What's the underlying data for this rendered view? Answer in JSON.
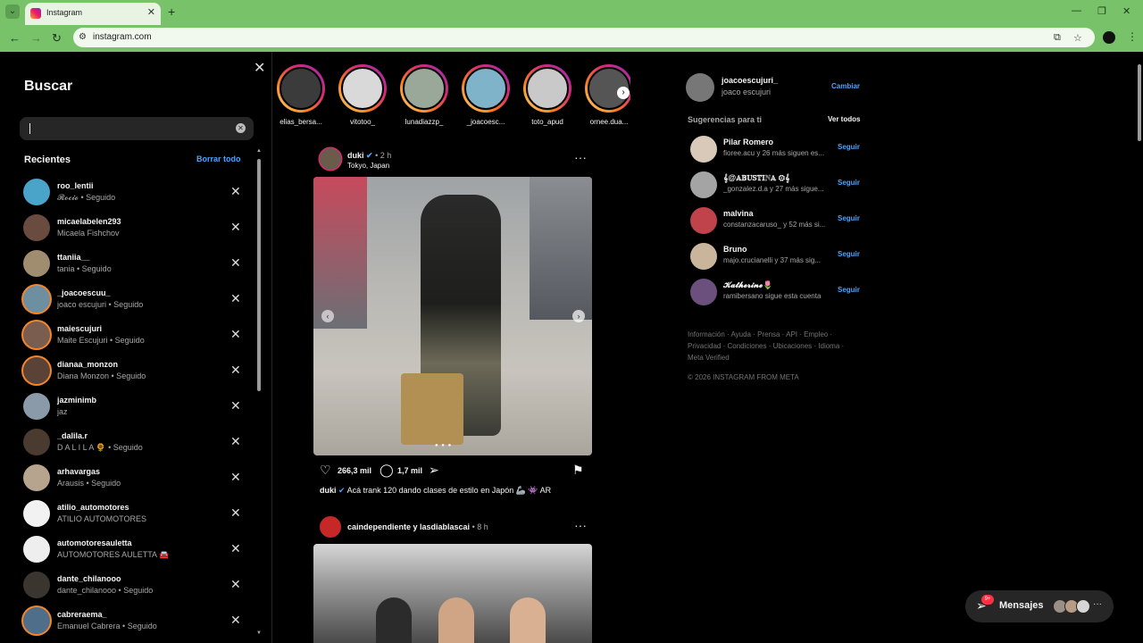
{
  "browser": {
    "tab_title": "Instagram",
    "url": "instagram.com"
  },
  "search": {
    "title": "Buscar",
    "input_value": "",
    "recent_title": "Recientes",
    "clear_all": "Borrar todo",
    "recents": [
      {
        "user": "roo_lentii",
        "sub": "𝓡𝓸𝓬𝓲𝓸 • Seguido",
        "avatar_color": "#4aa3c9"
      },
      {
        "user": "micaelabelen293",
        "sub": "Micaela Fishchov",
        "avatar_color": "#6a4b3f"
      },
      {
        "user": "ttaniia__",
        "sub": "tania • Seguido",
        "avatar_color": "#a08c6e"
      },
      {
        "user": "_joacoescuu_",
        "sub": "joaco escujuri • Seguido",
        "avatar_color": "#6d8fa0"
      },
      {
        "user": "maiescujuri",
        "sub": "Maite Escujuri • Seguido",
        "avatar_color": "#7a5d4f"
      },
      {
        "user": "dianaa_monzon",
        "sub": "Diana Monzon • Seguido",
        "avatar_color": "#5b4236"
      },
      {
        "user": "jazminimb",
        "sub": "jaz",
        "avatar_color": "#8a9aa8"
      },
      {
        "user": "_dalila.r",
        "sub": "D A L I L A 🌻 • Seguido",
        "avatar_color": "#4a3a30"
      },
      {
        "user": "arhavargas",
        "sub": "Arausis • Seguido",
        "avatar_color": "#b6a48f"
      },
      {
        "user": "atilio_automotores",
        "sub": "ATILIO AUTOMOTORES",
        "avatar_color": "#f2f2f2"
      },
      {
        "user": "automotoresauletta",
        "sub": "AUTOMOTORES AULETTA 🚘",
        "avatar_color": "#eeeeee"
      },
      {
        "user": "dante_chilanooo",
        "sub": "dante_chilanooo • Seguido",
        "avatar_color": "#3a352f"
      },
      {
        "user": "cabreraema_",
        "sub": "Emanuel Cabrera • Seguido",
        "avatar_color": "#4e6e8a"
      }
    ]
  },
  "stories": [
    {
      "name": "elias_bersa...",
      "color": "#3b3b3b"
    },
    {
      "name": "vitotoo_",
      "color": "#d9d9d9"
    },
    {
      "name": "lunadiazzp_",
      "color": "#9aa89a"
    },
    {
      "name": "_joacoesc...",
      "color": "#7fb3c9"
    },
    {
      "name": "toto_apud",
      "color": "#c9c9c9"
    },
    {
      "name": "ornee.dua...",
      "color": "#555555"
    }
  ],
  "post1": {
    "user": "duki",
    "verified": "✔",
    "time": "• 2 h",
    "location": "Tokyo, Japan",
    "likes": "266,3 mil",
    "comments": "1,7 mil",
    "caption_user": "duki",
    "caption_text": "Acá trank 120 dando clases de estilo en Japón 🦾 👾 AR"
  },
  "post2": {
    "user": "caindependiente y lasdiablascai",
    "time": "• 8 h"
  },
  "profile": {
    "user": "joacoescujuri_",
    "name": "joaco escujuri",
    "switch": "Cambiar"
  },
  "suggestions": {
    "title": "Sugerencias para ti",
    "see_all": "Ver todos",
    "follow_label": "Seguir",
    "items": [
      {
        "user": "Pilar Romero",
        "sub": "fioree.acu y 26 más siguen es...",
        "color": "#d8c9b8"
      },
      {
        "user": "𝄞@𝔸𝔹𝕌𝕊𝕋𝕀ℕ𝔸 ⚙𝄞",
        "sub": "_gonzalez.d.a y 27 más sigue...",
        "color": "#a4a4a4"
      },
      {
        "user": "malvina",
        "sub": "constanzacaruso_ y 52 más si...",
        "color": "#c0424a"
      },
      {
        "user": "Bruno",
        "sub": "majo.crucianelli y 37 más sig...",
        "color": "#c8b59c"
      },
      {
        "user": "𝓚𝓪𝓽𝓱𝓮𝓻𝓲𝓷𝓮🌷",
        "sub": "ramibersano sigue esta cuenta",
        "color": "#6b4f7c"
      }
    ]
  },
  "footer": {
    "links": "Información · Ayuda · Prensa · API · Empleo · Privacidad · Condiciones · Ubicaciones · Idioma · Meta Verified",
    "copyright": "© 2026 INSTAGRAM FROM META"
  },
  "messages": {
    "label": "Mensajes",
    "badge": "9+"
  },
  "colors": {
    "browser_frame": "#78c26a",
    "link_blue": "#4da3ff",
    "background": "#000000"
  }
}
